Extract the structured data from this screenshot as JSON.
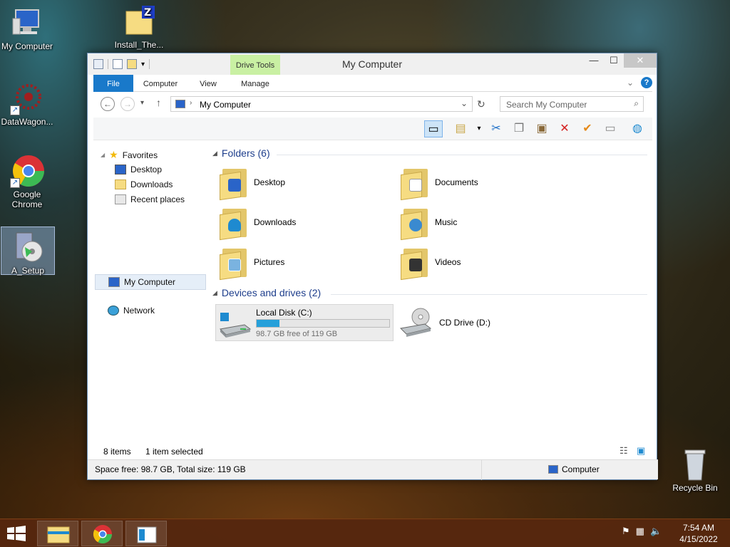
{
  "desktop": {
    "icons": [
      {
        "label": "My Computer"
      },
      {
        "label": "Install_The..."
      },
      {
        "label": "DataWagon..."
      },
      {
        "label": "Google Chrome"
      },
      {
        "label": "A_Setup"
      },
      {
        "label": "Recycle Bin"
      }
    ]
  },
  "window": {
    "title": "My Computer",
    "context_tab": "Drive Tools",
    "tabs": [
      "File",
      "Computer",
      "View",
      "Manage"
    ],
    "address": "My Computer",
    "search_placeholder": "Search My Computer"
  },
  "nav": {
    "favorites": "Favorites",
    "desktop": "Desktop",
    "downloads": "Downloads",
    "recent": "Recent places",
    "my_computer": "My Computer",
    "network": "Network"
  },
  "content": {
    "folders_header": "Folders (6)",
    "folders": [
      "Desktop",
      "Documents",
      "Downloads",
      "Music",
      "Pictures",
      "Videos"
    ],
    "devices_header": "Devices and drives (2)",
    "drives": [
      {
        "name": "Local Disk (C:)",
        "free": "98.7 GB free of 119 GB",
        "used_fraction": 0.17
      },
      {
        "name": "CD Drive (D:)"
      }
    ]
  },
  "status": {
    "items": "8 items",
    "selected": "1 item selected",
    "space": "Space free: 98.7 GB, Total size: 119 GB",
    "location": "Computer"
  },
  "taskbar": {
    "time": "7:54 AM",
    "date": "4/15/2022"
  },
  "colors": {
    "accent": "#1979ca",
    "drive_bar": "#26a0da",
    "drive_tools_tab": "#c9f0a3"
  }
}
